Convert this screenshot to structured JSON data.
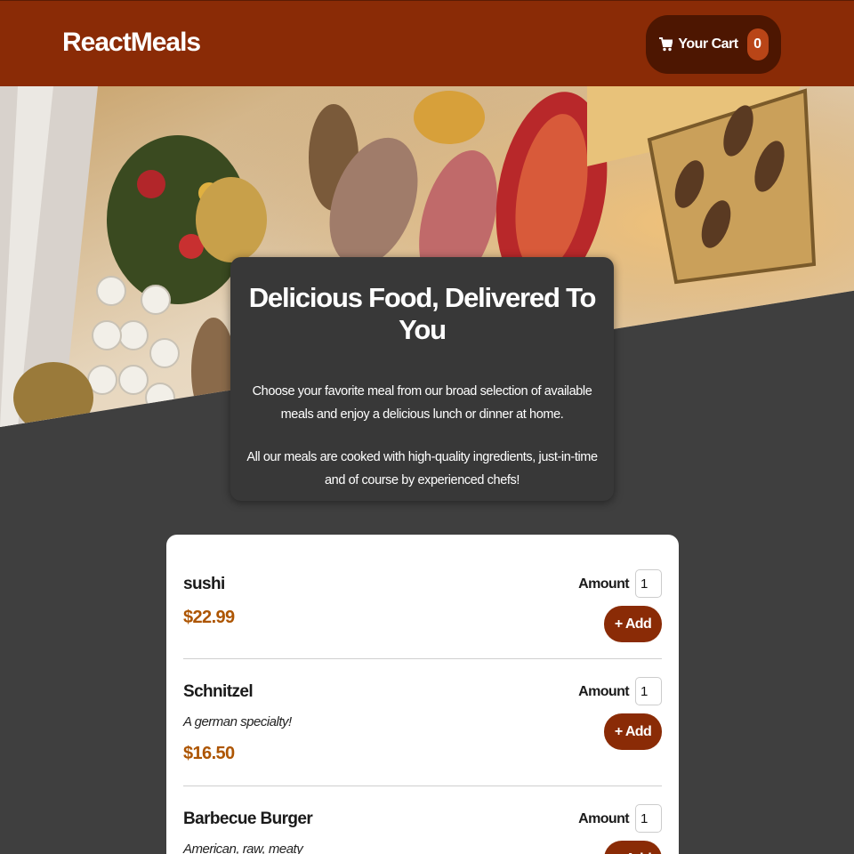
{
  "header": {
    "brand": "ReactMeals",
    "cart_label": "Your Cart",
    "cart_count": "0",
    "cart_icon": "cart-icon"
  },
  "summary": {
    "title": "Delicious Food, Delivered To You",
    "paragraph_1": "Choose your favorite meal from our broad selection of available meals and enjoy a delicious lunch or dinner at home.",
    "paragraph_2": "All our meals are cooked with high-quality ingredients, just-in-time and of course by experienced chefs!"
  },
  "meals": {
    "amount_label": "Amount",
    "add_label": "+ Add",
    "items": [
      {
        "name": "sushi",
        "description": "",
        "price": "$22.99",
        "amount": "1"
      },
      {
        "name": "Schnitzel",
        "description": "A german specialty!",
        "price": "$16.50",
        "amount": "1"
      },
      {
        "name": "Barbecue Burger",
        "description": "American, raw, meaty",
        "price": "",
        "amount": "1"
      }
    ]
  },
  "colors": {
    "header": "#8a2b06",
    "cart_button": "#4d1601",
    "badge": "#b94517",
    "background": "#3f3f3f",
    "price": "#ad5502"
  }
}
